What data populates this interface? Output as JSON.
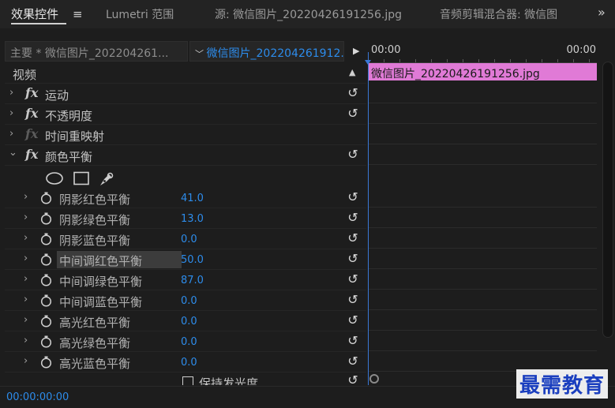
{
  "tabs": {
    "effects": "效果控件",
    "menu_icon": "hamburger-icon",
    "lumetri": "Lumetri 范围",
    "source": "源: 微信图片_20220426191256.jpg",
    "mixer": "音频剪辑混合器: 微信图",
    "more": "»"
  },
  "header": {
    "master": "主要 * 微信图片_202204261...",
    "sequence": "微信图片_202204261912...",
    "play": "▶"
  },
  "timeline": {
    "start": "00:00",
    "end": "00:00",
    "clip_label": "微信图片_20220426191256.jpg",
    "clip_color": "#e07ad6",
    "playhead_color": "#3a78d6"
  },
  "panel": {
    "video_label": "视频",
    "effects": [
      {
        "name": "运动"
      },
      {
        "name": "不透明度"
      },
      {
        "name": "时间重映射"
      },
      {
        "name": "颜色平衡"
      }
    ],
    "params": [
      {
        "name": "阴影红色平衡",
        "value": "41.0"
      },
      {
        "name": "阴影绿色平衡",
        "value": "13.0"
      },
      {
        "name": "阴影蓝色平衡",
        "value": "0.0"
      },
      {
        "name": "中间调红色平衡",
        "value": "50.0"
      },
      {
        "name": "中间调绿色平衡",
        "value": "87.0"
      },
      {
        "name": "中间调蓝色平衡",
        "value": "0.0"
      },
      {
        "name": "高光红色平衡",
        "value": "0.0"
      },
      {
        "name": "高光绿色平衡",
        "value": "0.0"
      },
      {
        "name": "高光蓝色平衡",
        "value": "0.0"
      }
    ],
    "preserve_label": "保持发光度",
    "accent": "#2d8ceb"
  },
  "footer": {
    "timecode": "00:00:00:00"
  },
  "watermark": "最需教育"
}
